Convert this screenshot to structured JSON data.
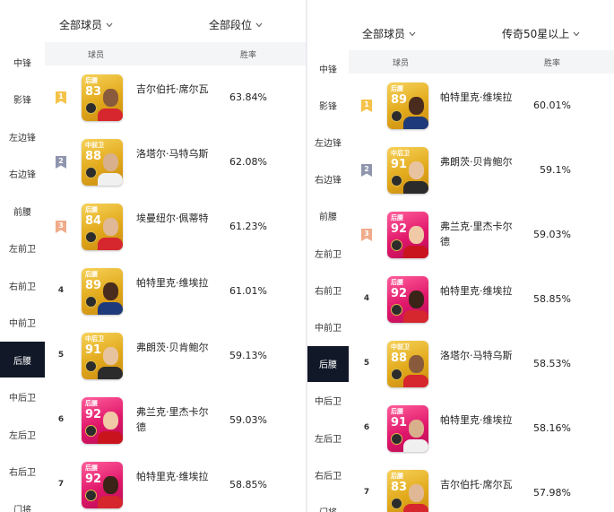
{
  "left": {
    "filter_players": "全部球员",
    "filter_rank": "全部段位",
    "col_player": "球员",
    "col_winrate": "胜率",
    "positions": [
      "中锋",
      "影锋",
      "左边锋",
      "右边锋",
      "前腰",
      "左前卫",
      "右前卫",
      "中前卫",
      "后腰",
      "中后卫",
      "左后卫",
      "右后卫",
      "门将"
    ],
    "active_position": "后腰",
    "rows": [
      {
        "rank": "1",
        "card_pos": "后腰",
        "rating": "83",
        "card_color": "gold",
        "name": "吉尔伯托·席尔瓦",
        "winrate": "63.84%"
      },
      {
        "rank": "2",
        "card_pos": "中前卫",
        "rating": "88",
        "card_color": "gold",
        "name": "洛塔尔·马特乌斯",
        "winrate": "62.08%"
      },
      {
        "rank": "3",
        "card_pos": "后腰",
        "rating": "84",
        "card_color": "gold",
        "name": "埃曼纽尔·佩蒂特",
        "winrate": "61.23%"
      },
      {
        "rank": "4",
        "card_pos": "后腰",
        "rating": "89",
        "card_color": "gold",
        "name": "帕特里克·维埃拉",
        "winrate": "61.01%"
      },
      {
        "rank": "5",
        "card_pos": "中后卫",
        "rating": "91",
        "card_color": "gold",
        "name": "弗朗茨·贝肯鲍尔",
        "winrate": "59.13%"
      },
      {
        "rank": "6",
        "card_pos": "后腰",
        "rating": "92",
        "card_color": "pink",
        "name": "弗兰克·里杰卡尔德",
        "winrate": "59.03%"
      },
      {
        "rank": "7",
        "card_pos": "后腰",
        "rating": "92",
        "card_color": "pink",
        "name": "帕特里克·维埃拉",
        "winrate": "58.85%"
      }
    ]
  },
  "right": {
    "filter_players": "全部球员",
    "filter_rank": "传奇50星以上",
    "col_player": "球员",
    "col_winrate": "胜率",
    "positions": [
      "中锋",
      "影锋",
      "左边锋",
      "右边锋",
      "前腰",
      "左前卫",
      "右前卫",
      "中前卫",
      "后腰",
      "中后卫",
      "左后卫",
      "右后卫",
      "门将"
    ],
    "active_position": "后腰",
    "rows": [
      {
        "rank": "1",
        "card_pos": "后腰",
        "rating": "89",
        "card_color": "gold",
        "name": "帕特里克·维埃拉",
        "winrate": "60.01%"
      },
      {
        "rank": "2",
        "card_pos": "中后卫",
        "rating": "91",
        "card_color": "gold",
        "name": "弗朗茨·贝肯鲍尔",
        "winrate": "59.1%"
      },
      {
        "rank": "3",
        "card_pos": "后腰",
        "rating": "92",
        "card_color": "pink",
        "name": "弗兰克·里杰卡尔德",
        "winrate": "59.03%"
      },
      {
        "rank": "4",
        "card_pos": "后腰",
        "rating": "92",
        "card_color": "pink",
        "name": "帕特里克·维埃拉",
        "winrate": "58.85%"
      },
      {
        "rank": "5",
        "card_pos": "中前卫",
        "rating": "88",
        "card_color": "gold",
        "name": "洛塔尔·马特乌斯",
        "winrate": "58.53%"
      },
      {
        "rank": "6",
        "card_pos": "后腰",
        "rating": "91",
        "card_color": "pink",
        "name": "帕特里克·维埃拉",
        "winrate": "58.16%"
      },
      {
        "rank": "7",
        "card_pos": "后腰",
        "rating": "83",
        "card_color": "gold",
        "name": "吉尔伯托·席尔瓦",
        "winrate": "57.98%"
      }
    ]
  },
  "colors": {
    "active_bg": "#111827",
    "rank1": "#f5c24a",
    "rank2": "#8f95ad",
    "rank3": "#f0ab8a",
    "gold_card": "#e2a91b",
    "pink_card": "#e0166a"
  }
}
